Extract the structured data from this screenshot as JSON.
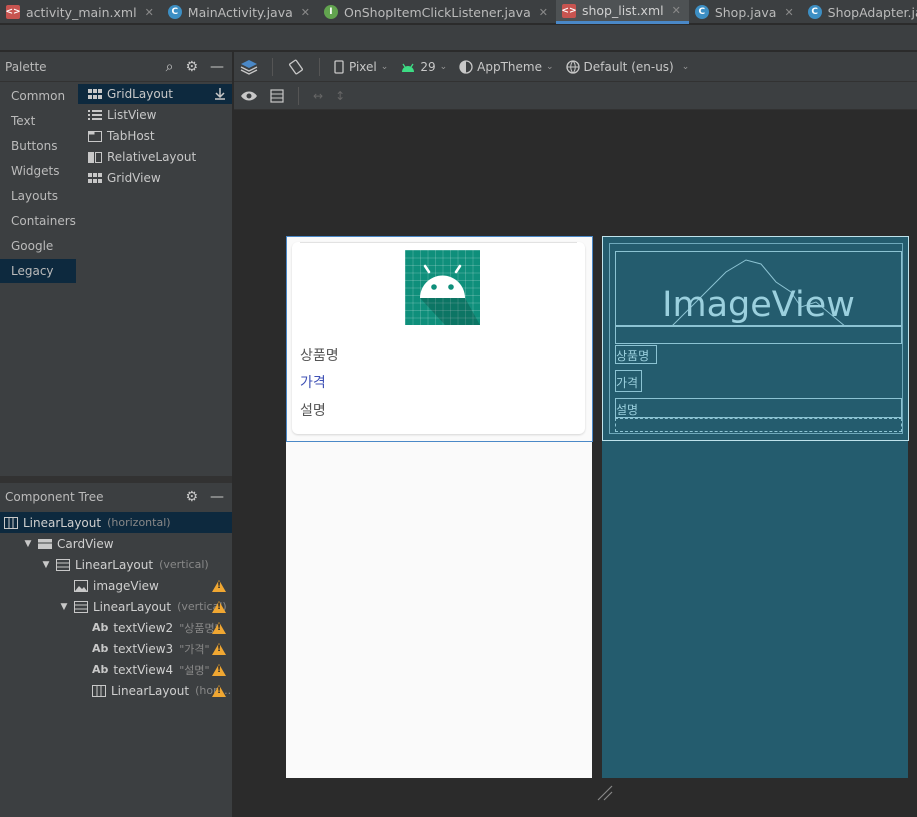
{
  "tabs": [
    {
      "label": "activity_main.xml",
      "icon": "xml-file-icon"
    },
    {
      "label": "MainActivity.java",
      "icon": "class-icon",
      "badge": "C"
    },
    {
      "label": "OnShopItemClickListener.java",
      "icon": "interface-icon",
      "badge": "I"
    },
    {
      "label": "shop_list.xml",
      "icon": "xml-file-icon",
      "active": true
    },
    {
      "label": "Shop.java",
      "icon": "class-icon",
      "badge": "C"
    },
    {
      "label": "ShopAdapter.java",
      "icon": "class-icon",
      "badge": "C"
    }
  ],
  "palette": {
    "title": "Palette",
    "categories": [
      "Common",
      "Text",
      "Buttons",
      "Widgets",
      "Layouts",
      "Containers",
      "Google",
      "Legacy"
    ],
    "selected_category": "Legacy",
    "items": [
      "GridLayout",
      "ListView",
      "TabHost",
      "RelativeLayout",
      "GridView"
    ]
  },
  "component_tree": {
    "title": "Component Tree",
    "rows": [
      {
        "label": "LinearLayout",
        "sub": "(horizontal)",
        "icon": "linear-horizontal-icon",
        "indent": 0,
        "arrow": "",
        "warn": false,
        "selected": true
      },
      {
        "label": "CardView",
        "sub": "",
        "icon": "cardview-icon",
        "indent": 1,
        "arrow": "▼",
        "warn": false
      },
      {
        "label": "LinearLayout",
        "sub": "(vertical)",
        "icon": "linear-vertical-icon",
        "indent": 2,
        "arrow": "▼",
        "warn": false
      },
      {
        "label": "imageView",
        "sub": "",
        "icon": "image-icon",
        "indent": 3,
        "arrow": "",
        "warn": true
      },
      {
        "label": "LinearLayout",
        "sub": "(vertical)",
        "icon": "linear-vertical-icon",
        "indent": 3,
        "arrow": "▼",
        "warn": true
      },
      {
        "label": "textView2",
        "sub": "\"상품명\"",
        "icon": "text-icon",
        "indent": 4,
        "arrow": "",
        "warn": true
      },
      {
        "label": "textView3",
        "sub": "\"가격\"",
        "icon": "text-icon",
        "indent": 4,
        "arrow": "",
        "warn": true
      },
      {
        "label": "textView4",
        "sub": "\"설명\"",
        "icon": "text-icon",
        "indent": 4,
        "arrow": "",
        "warn": true
      },
      {
        "label": "LinearLayout",
        "sub": "(hori...",
        "icon": "linear-horizontal-icon",
        "indent": 4,
        "arrow": "",
        "warn": true
      }
    ]
  },
  "design_toolbar": {
    "device": "Pixel",
    "api": "29",
    "theme": "AppTheme",
    "locale": "Default (en-us)"
  },
  "preview": {
    "name": "상품명",
    "price": "가격",
    "desc": "설명"
  },
  "blueprint": {
    "image_label": "ImageView",
    "name": "상품명",
    "price": "가격",
    "desc": "설명"
  }
}
